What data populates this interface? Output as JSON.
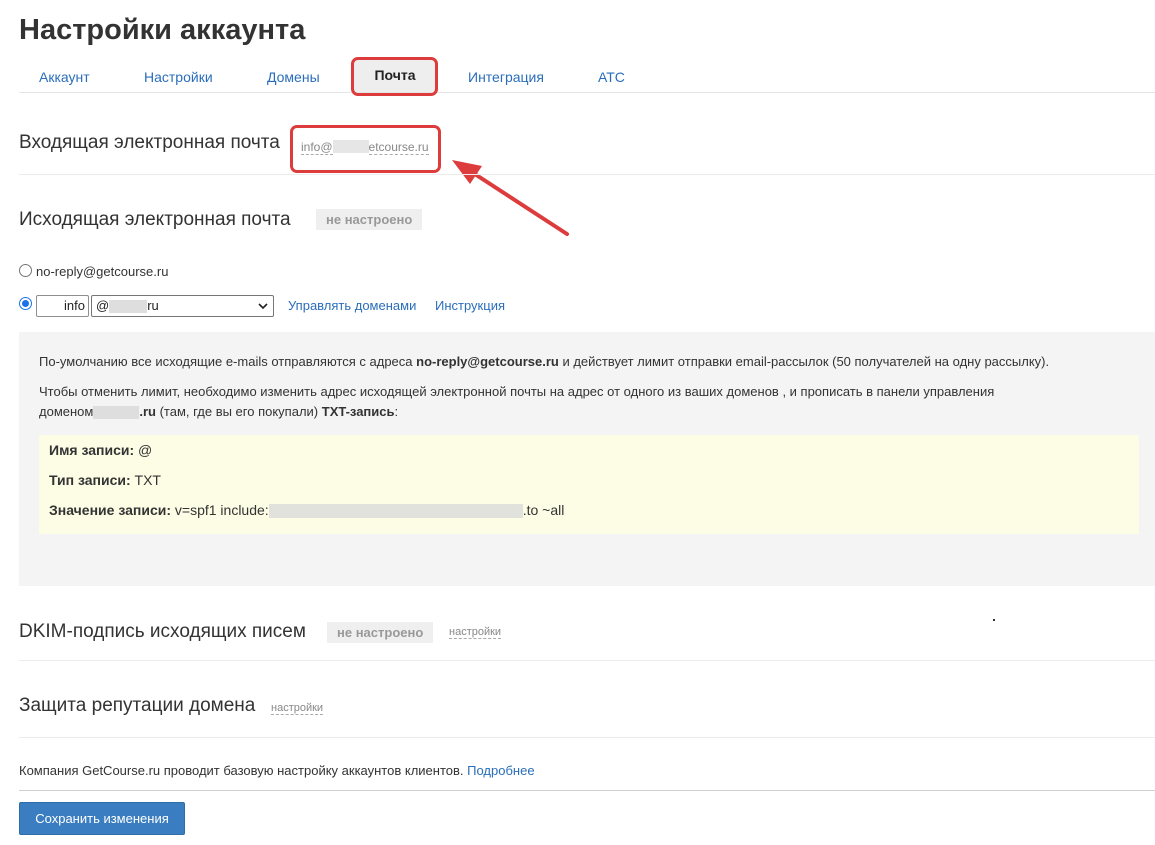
{
  "page": {
    "title": "Настройки аккаунта"
  },
  "tabs": [
    {
      "label": "Аккаунт"
    },
    {
      "label": "Настройки"
    },
    {
      "label": "Домены"
    },
    {
      "label": "Почта",
      "active": true
    },
    {
      "label": "Интеграция"
    },
    {
      "label": "АТС"
    }
  ],
  "incoming": {
    "label": "Входящая электронная почта",
    "email_prefix": "info@",
    "email_suffix": "etcourse.ru"
  },
  "outgoing": {
    "label": "Исходящая электронная почта",
    "status": "не настроено",
    "option_default": "no-reply@getcourse.ru",
    "mailbox_value": "info",
    "domain_prefix": "@",
    "domain_suffix": "ru",
    "manage_domains_link": "Управлять доменами",
    "instruction_link": "Инструкция"
  },
  "info": {
    "line1_pre": "По-умолчанию все исходящие e-mails отправляются с адреса ",
    "line1_bold": "no-reply@getcourse.ru",
    "line1_post": " и действует лимит отправки email-рассылок (50 получателей на одну рассылку).",
    "line2": "Чтобы отменить лимит, необходимо изменить адрес исходящей электронной почты на адрес от одного из ваших доменов   , и прописать в панели управления",
    "line3_pre": "доменом",
    "line3_bold": ".ru",
    "line3_mid": " (там, где вы его покупали) ",
    "line3_bold2": "TXT-запись",
    "line3_post": ":"
  },
  "dns": {
    "name_label": "Имя записи:",
    "name_value": "@",
    "type_label": "Тип записи:",
    "type_value": "TXT",
    "value_label": "Значение записи:",
    "value_prefix": "v=spf1 include:",
    "value_suffix": ".to ~all"
  },
  "dkim": {
    "label": "DKIM-подпись исходящих писем",
    "status": "не настроено",
    "settings_link": "настройки"
  },
  "reputation": {
    "label": "Защита репутации домена",
    "settings_link": "настройки"
  },
  "footer": {
    "note": "Компания GetCourse.ru проводит базовую настройку аккаунтов клиентов.",
    "more_link": "Подробнее",
    "save_button": "Сохранить изменения"
  },
  "colors": {
    "link": "#2a6ebb",
    "highlight": "#dc3c3c",
    "primary_button": "#3a7dc0",
    "info_panel": "#f4f4f4",
    "dns_box": "#fdfde5"
  }
}
